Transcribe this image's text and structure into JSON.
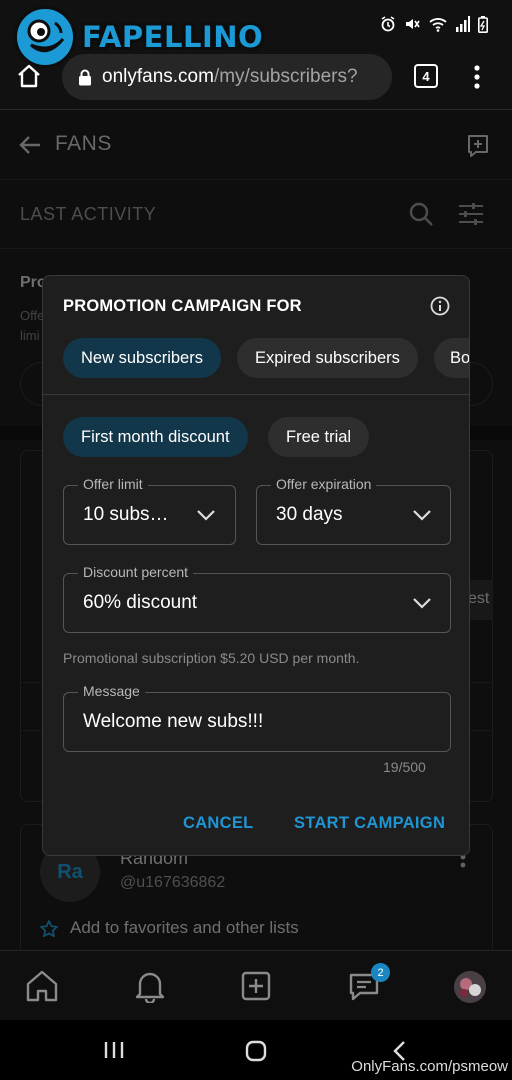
{
  "logo": {
    "text": "FAPELLINO"
  },
  "browser": {
    "url_domain": "onlyfans.com",
    "url_path": "/my/subscribers?",
    "tab_count": "4"
  },
  "page": {
    "title": "FANS",
    "filter_label": "LAST ACTIVITY",
    "partial_title": "Pro",
    "partial_text_1": "Offe",
    "partial_text_2": "limi",
    "partial_side_text": "est",
    "card": {
      "avatar_initials": "Ra",
      "name": "Random",
      "handle": "@u167636862",
      "favorites_text": "Add to favorites and other lists"
    }
  },
  "bottom_nav": {
    "messages_badge": "2"
  },
  "modal": {
    "title": "PROMOTION CAMPAIGN FOR",
    "audience_chips": [
      "New subscribers",
      "Expired subscribers",
      "Bo"
    ],
    "type_chips": [
      "First month discount",
      "Free trial"
    ],
    "offer_limit": {
      "label": "Offer limit",
      "value": "10 subs…"
    },
    "offer_expiration": {
      "label": "Offer expiration",
      "value": "30 days"
    },
    "discount": {
      "label": "Discount percent",
      "value": "60% discount"
    },
    "helper_text": "Promotional subscription $5.20 USD per month.",
    "message": {
      "label": "Message",
      "value": "Welcome new subs!!!"
    },
    "char_counter": "19/500",
    "cancel_label": "CANCEL",
    "start_label": "START CAMPAIGN"
  },
  "watermark": "OnlyFans.com/psmeow",
  "colors": {
    "accent": "#1f95d3",
    "chip_active": "#12374a",
    "modal_bg": "#1e1e1e"
  }
}
